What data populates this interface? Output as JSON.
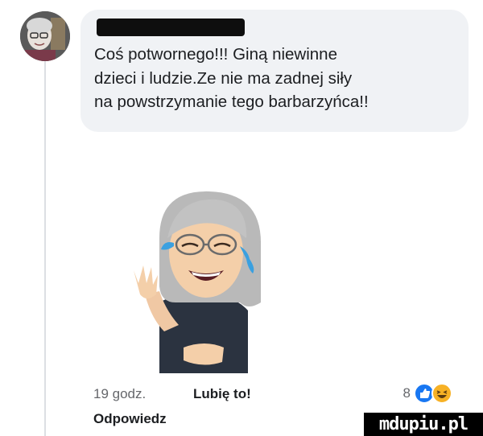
{
  "comment": {
    "author_redacted": true,
    "text": "Coś potwornego!!! Giną niewinne\ndzieci i ludzie.Ze nie ma zadnej siły\nna powstrzymanie tego barbarzyńca!!",
    "sticker": "crying-laughing-memoji",
    "time": "19 godz.",
    "like_label": "Lubię to!",
    "reply_label": "Odpowiedz",
    "reaction_count": "8",
    "reactions": [
      "like-icon",
      "laugh-icon"
    ]
  },
  "watermark": "mdupiu.pl",
  "colors": {
    "bubble": "#f0f2f5",
    "like_blue": "#1877f2",
    "laugh_yellow": "#f7b125",
    "meta_gray": "#65676b"
  }
}
